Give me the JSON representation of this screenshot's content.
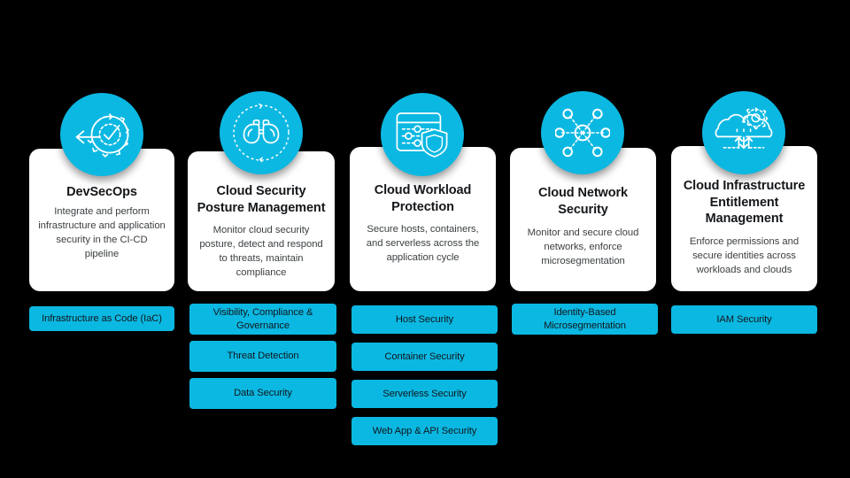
{
  "theme": {
    "background": "#000000",
    "accent": "#0bb8e2",
    "card_bg": "#ffffff",
    "title_color": "#14171a",
    "desc_color": "#3c4043",
    "pill_text_color": "#10171c"
  },
  "columns": [
    {
      "icon": "devsecops-gear-check-arrow-icon",
      "title": "DevSecOps",
      "description": "Integrate and perform infrastructure and application security in the CI-CD pipeline",
      "pills": [
        "Infrastructure as Code (IaC)"
      ]
    },
    {
      "icon": "binoculars-icon",
      "title": "Cloud Security Posture Management",
      "description": "Monitor cloud security posture, detect and respond to threats, maintain compliance",
      "pills": [
        "Visibility, Compliance & Governance",
        "Threat Detection",
        "Data Security"
      ]
    },
    {
      "icon": "dashboard-sliders-shield-icon",
      "title": "Cloud Workload Protection",
      "description": "Secure hosts, containers, and serverless across the application cycle",
      "pills": [
        "Host Security",
        "Container Security",
        "Serverless Security",
        "Web App & API Security"
      ]
    },
    {
      "icon": "network-hub-nodes-icon",
      "title": "Cloud Network Security",
      "description": "Monitor and secure cloud networks, enforce microsegmentation",
      "pills": [
        "Identity-Based Microsegmentation"
      ]
    },
    {
      "icon": "cloud-gear-arrows-icon",
      "title": "Cloud Infrastructure Entitlement Management",
      "description": "Enforce permissions and secure identities across workloads and clouds",
      "pills": [
        "IAM Security"
      ]
    }
  ]
}
